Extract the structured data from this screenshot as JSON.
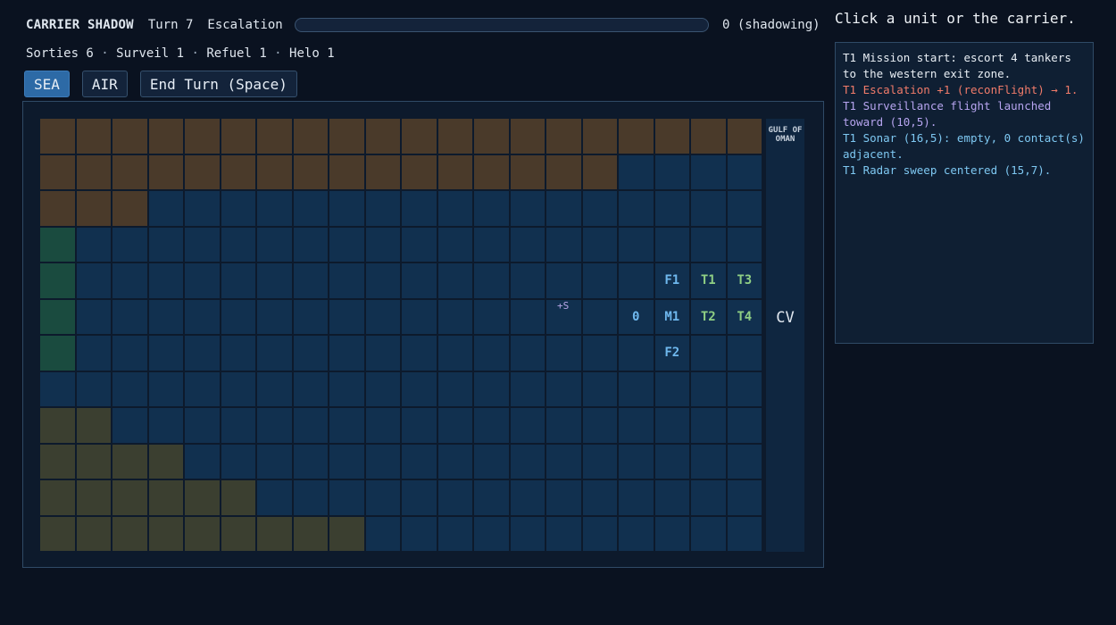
{
  "hud": {
    "title": "CARRIER SHADOW",
    "turn": "Turn 7",
    "escalation_label": "Escalation",
    "escalation_level": 0,
    "escalation_value": "0 (shadowing)",
    "prompt": "Click a unit or the carrier."
  },
  "resources": {
    "sorties": "Sorties 6",
    "surveil": "Surveil 1",
    "refuel": "Refuel 1",
    "helo": "Helo 1",
    "separator": " · "
  },
  "toolbar": {
    "sea_label": "SEA",
    "air_label": "AIR",
    "end_turn_label": "End Turn (Space)"
  },
  "map": {
    "edge_label": "GULF OF OMAN",
    "carrier_label": "CV",
    "sonar_marker": "+S",
    "units": {
      "f1": "F1",
      "f2": "F2",
      "t1": "T1",
      "t2": "T2",
      "t3": "T3",
      "t4": "T4",
      "m1": "M1",
      "contact": "0"
    }
  },
  "log": [
    {
      "text": "T1 Mission start: escort 4 tankers to the western exit zone.",
      "color": "white"
    },
    {
      "text": "T1 Escalation +1 (reconFlight) → 1.",
      "color": "red"
    },
    {
      "text": "T1 Surveillance flight launched toward (10,5).",
      "color": "purple"
    },
    {
      "text": "T1 Sonar (16,5): empty, 0 contact(s) adjacent.",
      "color": "blue"
    },
    {
      "text": "T1 Radar sweep centered (15,7).",
      "color": "blue"
    }
  ],
  "colors": {
    "sea": "#11304f",
    "land_north": "#4a3a2a",
    "land_south": "#3b3f30",
    "coast_green": "#1a4b3f",
    "accent": "#2d6aa6"
  }
}
